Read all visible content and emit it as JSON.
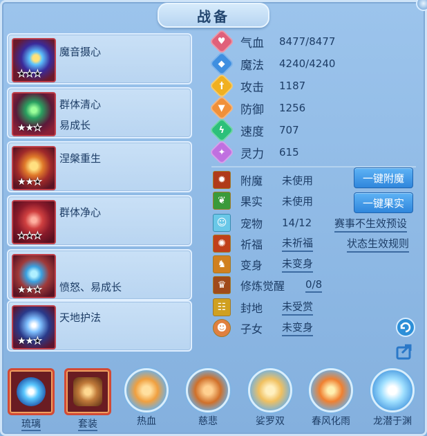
{
  "title": "战备",
  "skills": [
    {
      "name": "魔音摄心",
      "subtitle": "",
      "stars": 0
    },
    {
      "name": "群体清心",
      "subtitle": "易成长",
      "stars": 2
    },
    {
      "name": "涅槃重生",
      "subtitle": "",
      "stars": 2
    },
    {
      "name": "群体净心",
      "subtitle": "",
      "stars": 0
    },
    {
      "name": "",
      "subtitle": "愤怒、易成长",
      "stars": 2
    },
    {
      "name": "天地护法",
      "subtitle": "",
      "stars": 2
    }
  ],
  "stats": [
    {
      "label": "气血",
      "value": "8477/8477",
      "icon": "heart-icon",
      "color": "#e0607a"
    },
    {
      "label": "魔法",
      "value": "4240/4240",
      "icon": "mana-icon",
      "color": "#3f8fe0"
    },
    {
      "label": "攻击",
      "value": "1187",
      "icon": "sword-icon",
      "color": "#f0b020"
    },
    {
      "label": "防御",
      "value": "1256",
      "icon": "shield-icon",
      "color": "#f0903a"
    },
    {
      "label": "速度",
      "value": "707",
      "icon": "lightning-icon",
      "color": "#2cc07a"
    },
    {
      "label": "灵力",
      "value": "615",
      "icon": "sparkle-icon",
      "color": "#c070e0"
    }
  ],
  "misc": [
    {
      "label": "附魔",
      "value": "未使用",
      "underline": false,
      "icon": "enchant-icon"
    },
    {
      "label": "果实",
      "value": "未使用",
      "underline": false,
      "icon": "fruit-icon"
    },
    {
      "label": "宠物",
      "value": "14/12",
      "underline": false,
      "icon": "pet-icon"
    },
    {
      "label": "祈福",
      "value": "未祈福",
      "underline": true,
      "icon": "blessing-icon"
    },
    {
      "label": "变身",
      "value": "未变身",
      "underline": true,
      "icon": "transform-icon"
    },
    {
      "label": "修炼觉醒",
      "value": "0/8",
      "underline": true,
      "icon": "cultivation-icon"
    },
    {
      "label": "封地",
      "value": "未受赏",
      "underline": true,
      "icon": "fief-icon"
    },
    {
      "label": "子女",
      "value": "未变身",
      "underline": true,
      "icon": "children-icon"
    }
  ],
  "buttons": {
    "enchant": "一键附魔",
    "fruit": "一键果实"
  },
  "links": {
    "preset": "赛事不生效预设",
    "rules": "状态生效规则"
  },
  "bottom": [
    {
      "label": "琉璃",
      "style": "square",
      "underline": true,
      "icon": "glass-orb-icon"
    },
    {
      "label": "套装",
      "style": "square",
      "underline": true,
      "icon": "armor-set-icon"
    },
    {
      "label": "热血",
      "style": "round",
      "underline": false,
      "icon": "hot-blood-icon"
    },
    {
      "label": "慈悲",
      "style": "round",
      "underline": false,
      "icon": "mercy-icon"
    },
    {
      "label": "娑罗双",
      "style": "round",
      "underline": false,
      "icon": "sala-icon"
    },
    {
      "label": "春风化雨",
      "style": "round",
      "underline": false,
      "icon": "spring-rain-icon"
    },
    {
      "label": "龙潜于渊",
      "style": "round",
      "underline": false,
      "icon": "dragon-icon"
    }
  ]
}
